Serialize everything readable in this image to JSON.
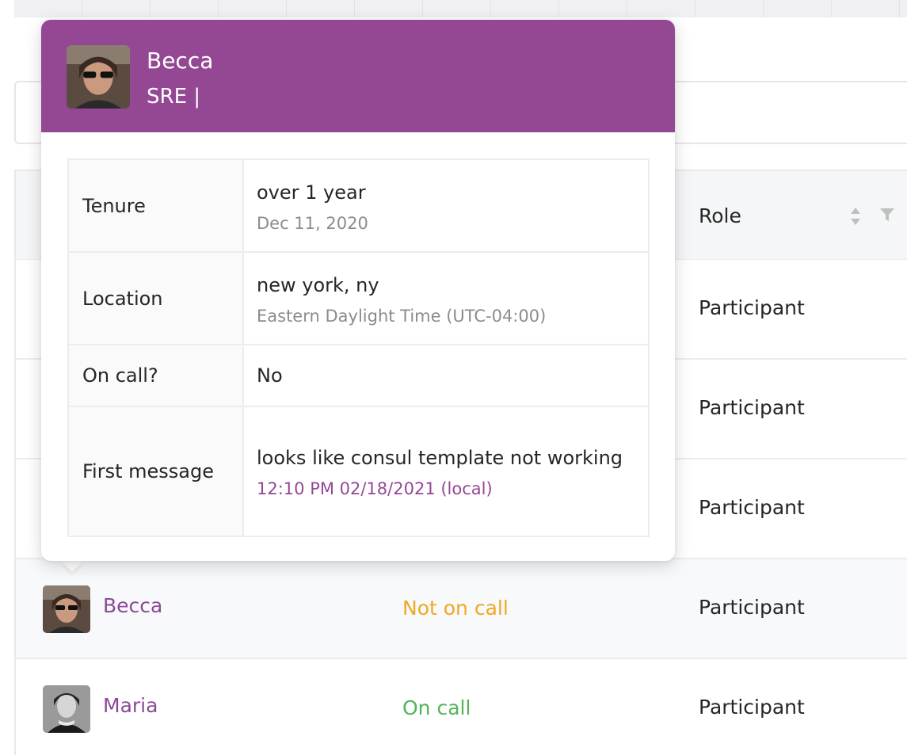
{
  "table": {
    "header": {
      "role_label": "Role"
    },
    "rows": [
      {
        "role": "Participant"
      },
      {
        "role": "Participant"
      },
      {
        "role": "Participant"
      },
      {
        "name": "Becca",
        "status": "Not on call",
        "role": "Participant"
      },
      {
        "name": "Maria",
        "status": "On call",
        "role": "Participant"
      }
    ]
  },
  "popover": {
    "name": "Becca",
    "role": "SRE |",
    "fields": {
      "tenure_label": "Tenure",
      "tenure_value": "over 1 year",
      "tenure_date": "Dec 11, 2020",
      "location_label": "Location",
      "location_value": "new york, ny",
      "location_tz": "Eastern Daylight Time (UTC-04:00)",
      "oncall_label": "On call?",
      "oncall_value": "No",
      "first_label": "First message",
      "first_value": "looks like consul template not working",
      "first_time": "12:10 PM 02/18/2021 (local)"
    }
  },
  "colors": {
    "accent": "#944894",
    "link": "#8c4a97",
    "not_on_call": "#f0a821",
    "on_call": "#52b45a"
  }
}
